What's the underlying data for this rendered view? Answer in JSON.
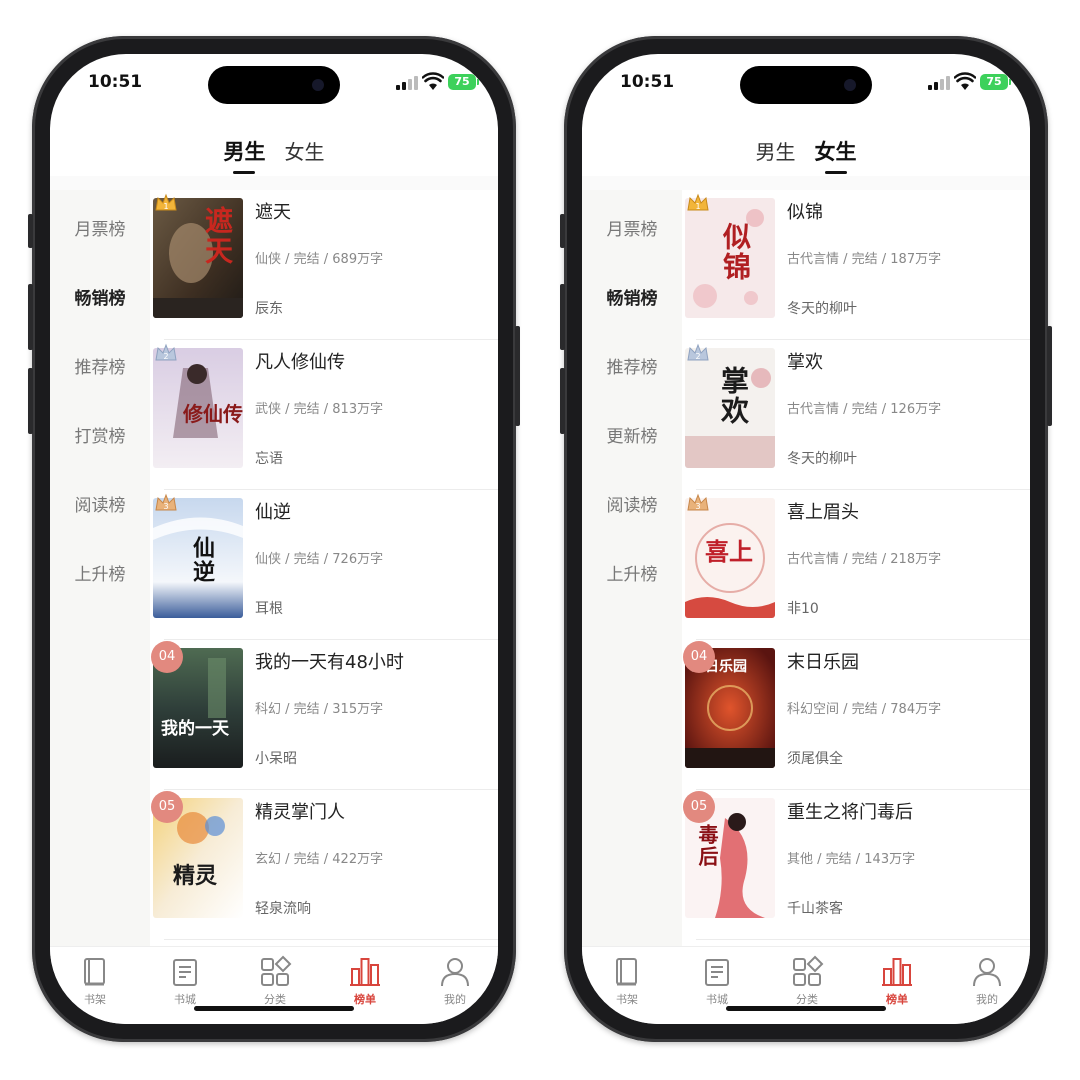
{
  "status": {
    "time": "10:51",
    "battery": "75"
  },
  "colors": {
    "accent": "#d8453d",
    "badge": "#e2897f",
    "battery": "#3dd15b"
  },
  "gender_tabs": [
    "男生",
    "女生"
  ],
  "nav": [
    {
      "label": "书架",
      "icon": "bookshelf-icon"
    },
    {
      "label": "书城",
      "icon": "bookstore-icon"
    },
    {
      "label": "分类",
      "icon": "category-icon"
    },
    {
      "label": "榜单",
      "icon": "ranking-icon"
    },
    {
      "label": "我的",
      "icon": "profile-icon"
    }
  ],
  "screens": [
    {
      "active_gender": "男生",
      "active_rank": "畅销榜",
      "rank_tabs": [
        "月票榜",
        "畅销榜",
        "推荐榜",
        "打赏榜",
        "阅读榜",
        "上升榜"
      ],
      "books": [
        {
          "rank": "01",
          "title": "遮天",
          "meta": "仙侠 / 完结 / 689万字",
          "author": "辰东",
          "cover_text": "遮天"
        },
        {
          "rank": "02",
          "title": "凡人修仙传",
          "meta": "武侠 / 完结 / 813万字",
          "author": "忘语",
          "cover_text": "修仙传"
        },
        {
          "rank": "03",
          "title": "仙逆",
          "meta": "仙侠 / 完结 / 726万字",
          "author": "耳根",
          "cover_text": "仙逆"
        },
        {
          "rank": "04",
          "title": "我的一天有48小时",
          "meta": "科幻 / 完结 / 315万字",
          "author": "小呆昭",
          "cover_text": "我的一天"
        },
        {
          "rank": "05",
          "title": "精灵掌门人",
          "meta": "玄幻 / 完结 / 422万字",
          "author": "轻泉流响",
          "cover_text": "精灵"
        }
      ]
    },
    {
      "active_gender": "女生",
      "active_rank": "畅销榜",
      "rank_tabs": [
        "月票榜",
        "畅销榜",
        "推荐榜",
        "更新榜",
        "阅读榜",
        "上升榜"
      ],
      "books": [
        {
          "rank": "01",
          "title": "似锦",
          "meta": "古代言情 / 完结 / 187万字",
          "author": "冬天的柳叶",
          "cover_text": "似锦"
        },
        {
          "rank": "02",
          "title": "掌欢",
          "meta": "古代言情 / 完结 / 126万字",
          "author": "冬天的柳叶",
          "cover_text": "掌欢"
        },
        {
          "rank": "03",
          "title": "喜上眉头",
          "meta": "古代言情 / 完结 / 218万字",
          "author": "非10",
          "cover_text": "喜上"
        },
        {
          "rank": "04",
          "title": "末日乐园",
          "meta": "科幻空间 / 完结 / 784万字",
          "author": "须尾俱全",
          "cover_text": "末日乐园"
        },
        {
          "rank": "05",
          "title": "重生之将门毒后",
          "meta": "其他 / 完结 / 143万字",
          "author": "千山茶客",
          "cover_text": "毒后"
        }
      ]
    }
  ]
}
